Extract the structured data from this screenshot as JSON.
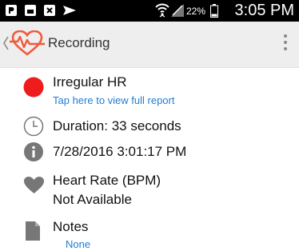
{
  "status_bar": {
    "battery_percent": "22%",
    "time": "3:05 PM",
    "icons": [
      "notification-icon",
      "gallery-icon",
      "close-box-icon",
      "paper-plane-icon",
      "wifi-icon",
      "signal-icon",
      "battery-icon"
    ]
  },
  "action_bar": {
    "title": "Recording",
    "icons": [
      "back-icon",
      "heart-pulse-logo-icon",
      "overflow-menu-icon"
    ]
  },
  "rows": {
    "result": {
      "title": "Irregular HR",
      "link": "Tap here to view full report",
      "color": "#ee1c1c"
    },
    "duration": {
      "text": "Duration: 33 seconds",
      "icon": "clock-icon"
    },
    "date": {
      "text": "7/28/2016 3:01:17 PM",
      "icon": "info-icon"
    },
    "heart_rate": {
      "label": "Heart Rate (BPM)",
      "value": "Not Available",
      "icon": "heart-icon"
    },
    "notes": {
      "label": "Notes",
      "value": "None",
      "icon": "document-icon"
    }
  },
  "colors": {
    "accent": "#f05a3a",
    "link": "#1f7ed6",
    "icon_gray": "#777777"
  }
}
